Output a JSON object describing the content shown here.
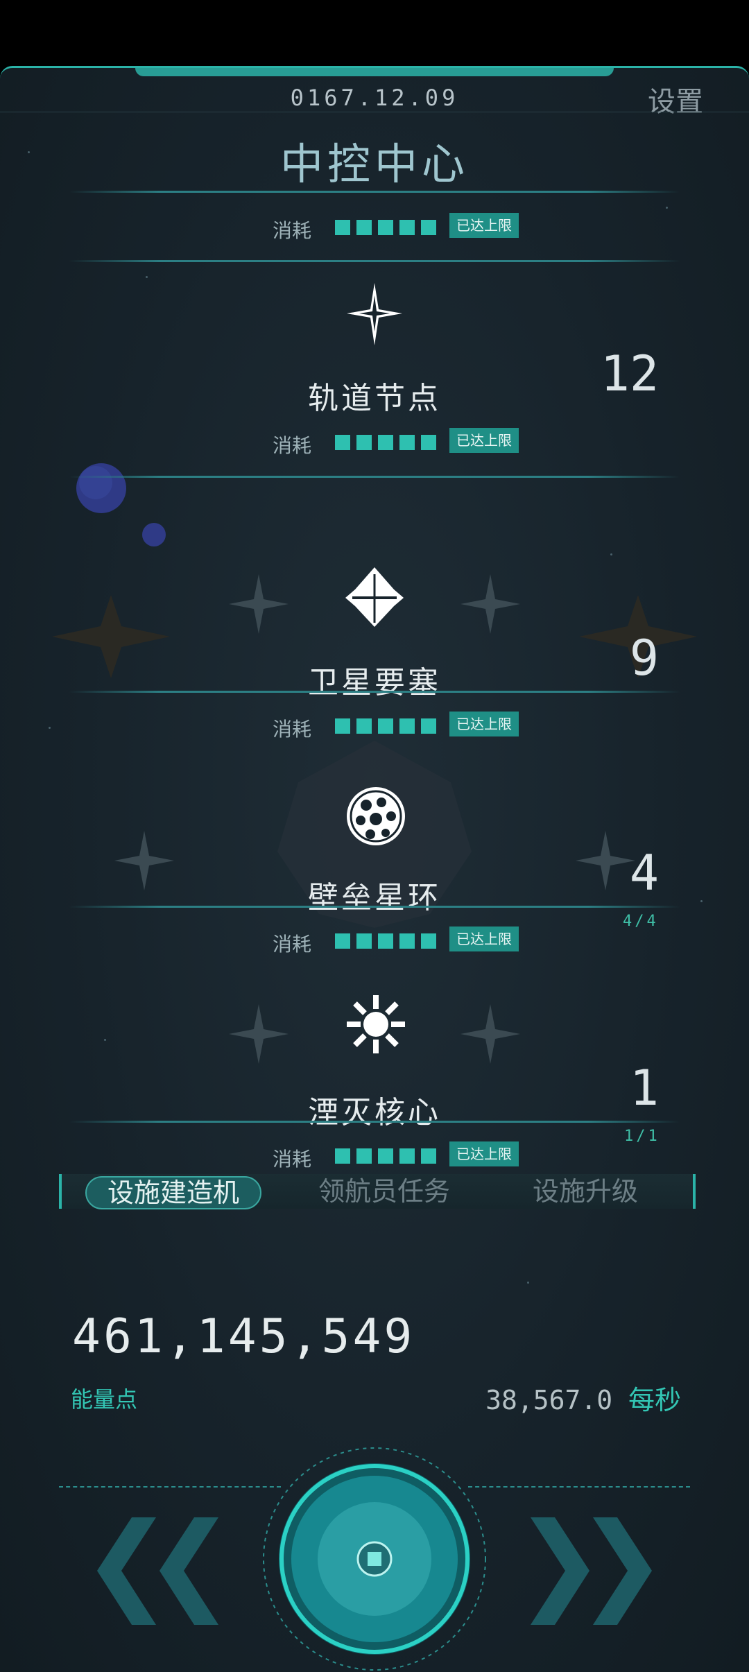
{
  "header": {
    "date": "0167.12.09",
    "settings_label": "设置",
    "title": "中控中心"
  },
  "top_cost": {
    "label": "消耗",
    "filled": 5,
    "badge": "已达上限"
  },
  "facilities": [
    {
      "name": "轨道节点",
      "count": "12",
      "sub_count": "",
      "cost_label": "消耗",
      "filled": 5,
      "badge": "已达上限"
    },
    {
      "name": "卫星要塞",
      "count": "9",
      "sub_count": "",
      "cost_label": "消耗",
      "filled": 5,
      "badge": "已达上限"
    },
    {
      "name": "壁垒星环",
      "count": "4",
      "sub_count": "4/4",
      "cost_label": "消耗",
      "filled": 5,
      "badge": "已达上限"
    },
    {
      "name": "湮灭核心",
      "count": "1",
      "sub_count": "1/1",
      "cost_label": "消耗",
      "filled": 5,
      "badge": "已达上限"
    }
  ],
  "tabs": [
    {
      "label": "设施建造机",
      "active": true
    },
    {
      "label": "领航员任务",
      "active": false
    },
    {
      "label": "设施升级",
      "active": false
    }
  ],
  "energy": {
    "value": "461,145,549",
    "label": "能量点",
    "rate": "38,567.0",
    "rate_unit": "每秒"
  },
  "colors": {
    "accent": "#2bb3a8",
    "badge": "#1f8f86",
    "background": "#17232b"
  },
  "icons": [
    "compass-star-icon",
    "satellite-fortress-icon",
    "sphere-ring-icon",
    "annihilation-core-icon",
    "left-double-chevron-icon",
    "right-double-chevron-icon",
    "main-tap-button-icon"
  ]
}
